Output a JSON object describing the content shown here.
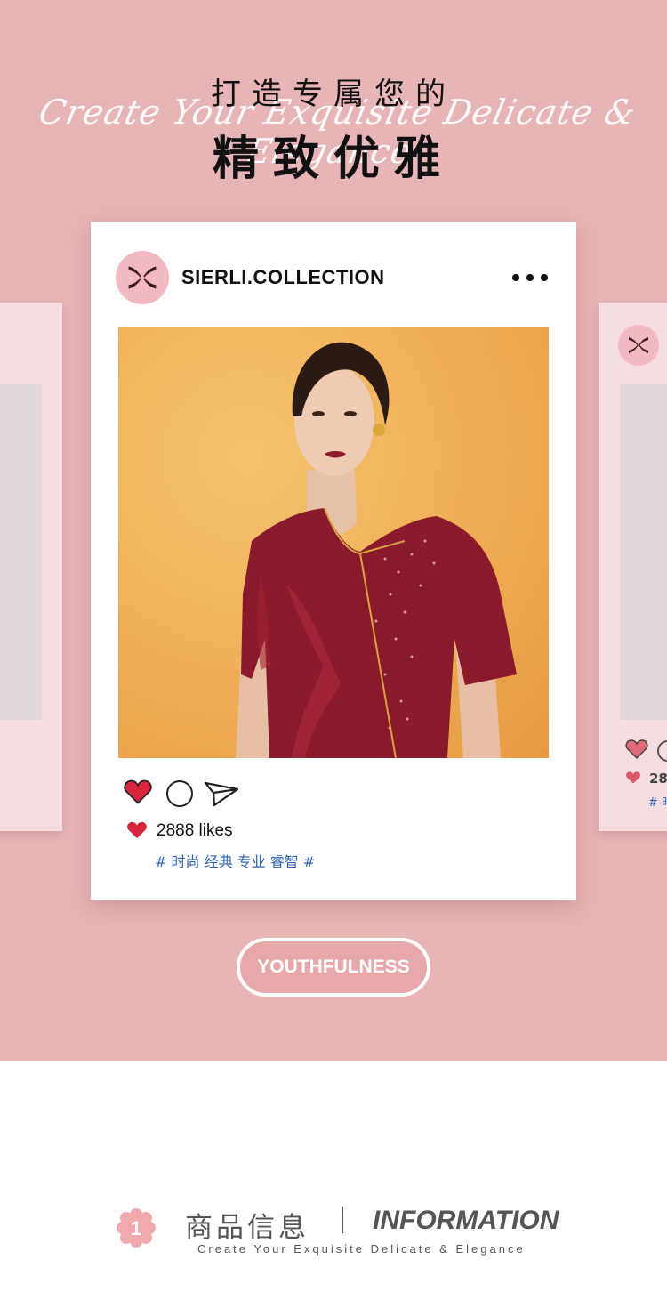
{
  "header": {
    "title_line1": "打造专属您的",
    "script_text": "Create Your Exquisite Delicate & Elegance",
    "title_line2": "精致优雅"
  },
  "post": {
    "account_name": "SIERLI.COLLECTION",
    "more_icon": "more-horizontal-icon",
    "likes_text": "2888 likes",
    "hashtags": "# 时尚 经典 专业 睿智 #",
    "like_color": "#d9263d"
  },
  "side_post": {
    "likes_text": "28",
    "tag_text": "# 时"
  },
  "tag_button": {
    "label": "YOUTHFULNESS"
  },
  "info_section": {
    "badge_number": "1",
    "title_cn": "商品信息",
    "title_en": "INFORMATION",
    "subtitle": "Create Your Exquisite Delicate & Elegance"
  },
  "colors": {
    "banner_pink": "#e8b5b7",
    "avatar_pink": "#f2b9c2",
    "hashtag_blue": "#2f62b3",
    "dress_red": "#8a1a2b"
  }
}
